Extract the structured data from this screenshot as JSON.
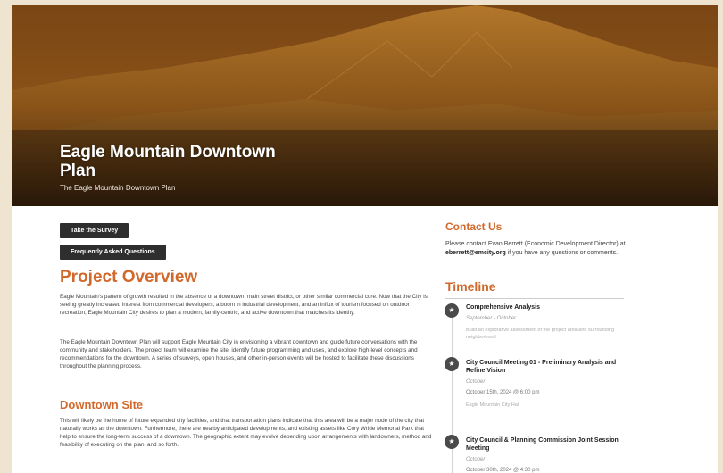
{
  "hero": {
    "title": "Eagle Mountain Downtown Plan",
    "subtitle": "The Eagle Mountain Downtown Plan"
  },
  "buttons": {
    "survey": "Take the Survey",
    "faq": "Frequently Asked Questions"
  },
  "overview": {
    "heading": "Project Overview",
    "p1": "Eagle Mountain's pattern of growth resulted in the absence of a downtown, main street district, or other similar commercial core. Now that the City is seeing greatly increased interest from commercial developers, a boom in industrial development, and an influx of tourism focused on outdoor recreation, Eagle Mountain City desires to plan a modern, family-centric, and active downtown that matches its identity.",
    "p2": "The Eagle Mountain Downtown Plan will support Eagle Mountain City in envisioning a vibrant downtown and guide future conversations with the community and stakeholders. The project team will examine the site, identify future programming and uses, and explore high-level concepts and recommendations for the downtown. A series of surveys, open houses, and other in-person events will be hosted to facilitate these discussions throughout the planning process."
  },
  "site": {
    "heading": "Downtown Site",
    "p1": "This will likely be the home of future expanded city facilities, and that transportation plans indicate that this area will be a major node of the city that naturally works as the downtown. Furthermore, there are nearby anticipated developments, and existing assets like Cory Wride Memorial Park that help to ensure the long-term success of a downtown. The geographic extent may evolve depending upon arrangements with landowners, method and feasibility of executing on the plan, and so forth."
  },
  "contact": {
    "heading": "Contact Us",
    "text_before": "Please contact Evan Berrett (Economic Development Director) at ",
    "email": "eberrett@emcity.org",
    "text_after": " if you have any questions or comments."
  },
  "timeline": {
    "heading": "Timeline",
    "items": [
      {
        "title": "Comprehensive Analysis",
        "date": "September - October",
        "note": "Build an explorative assessment of the project area and surrounding neighborhood"
      },
      {
        "title": "City Council Meeting 01 - Preliminary Analysis and Refine Vision",
        "date": "October",
        "time": "October 15th, 2024 @ 6:00 pm",
        "note": "Eagle Mountain City Hall"
      },
      {
        "title": "City Council & Planning Commission Joint Session Meeting",
        "date": "October",
        "time": "October 30th, 2024 @ 4:30 pm"
      }
    ]
  },
  "icons": {
    "timeline": "star-icon"
  },
  "colors": {
    "accent": "#d2692c",
    "button": "#2e2e2e"
  }
}
